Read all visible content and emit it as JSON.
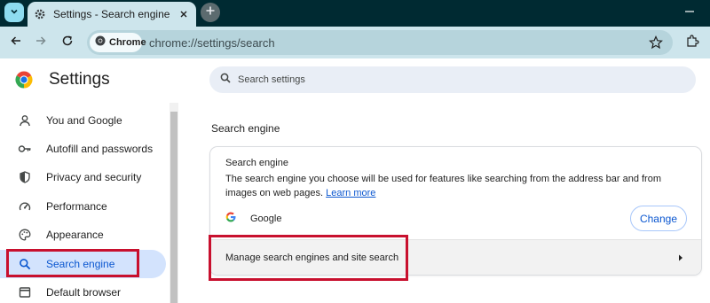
{
  "browser": {
    "tab": {
      "title": "Settings - Search engine"
    },
    "omnibox": {
      "chip_label": "Chrome",
      "url": "chrome://settings/search"
    }
  },
  "header": {
    "app_title": "Settings",
    "search": {
      "placeholder": "Search settings"
    }
  },
  "sidebar": {
    "items": [
      {
        "label": "You and Google",
        "icon": "person-icon"
      },
      {
        "label": "Autofill and passwords",
        "icon": "key-icon"
      },
      {
        "label": "Privacy and security",
        "icon": "shield-icon"
      },
      {
        "label": "Performance",
        "icon": "speedometer-icon"
      },
      {
        "label": "Appearance",
        "icon": "palette-icon"
      },
      {
        "label": "Search engine",
        "icon": "search-icon",
        "active": true
      },
      {
        "label": "Default browser",
        "icon": "browser-window-icon"
      }
    ]
  },
  "main": {
    "section_heading": "Search engine",
    "card": {
      "title": "Search engine",
      "description": "The search engine you choose will be used for features like searching from the address bar and from images on web pages.",
      "learn_more": "Learn more",
      "engine_name": "Google",
      "change_label": "Change",
      "manage_label": "Manage search engines and site search"
    }
  },
  "colors": {
    "tabstrip": "#002a32",
    "toolbar": "#cde5ec",
    "accent": "#0b57d0",
    "active_nav_bg": "#d3e3fd",
    "highlight_box": "#c8102e"
  }
}
